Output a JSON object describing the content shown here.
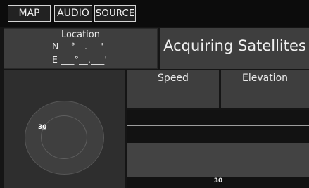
{
  "tabs": [
    {
      "label": "MAP"
    },
    {
      "label": "AUDIO"
    },
    {
      "label": "SOURCE"
    }
  ],
  "location": {
    "title": "Location",
    "north": "N __°__.___'",
    "east": "E ___°__.___'"
  },
  "status": "Acquiring Satellites",
  "metrics": {
    "speed_label": "Speed",
    "elevation_label": "Elevation"
  },
  "sky_view": {
    "satellite_label": "30"
  },
  "signal_chart": {
    "bar_label": "30"
  }
}
